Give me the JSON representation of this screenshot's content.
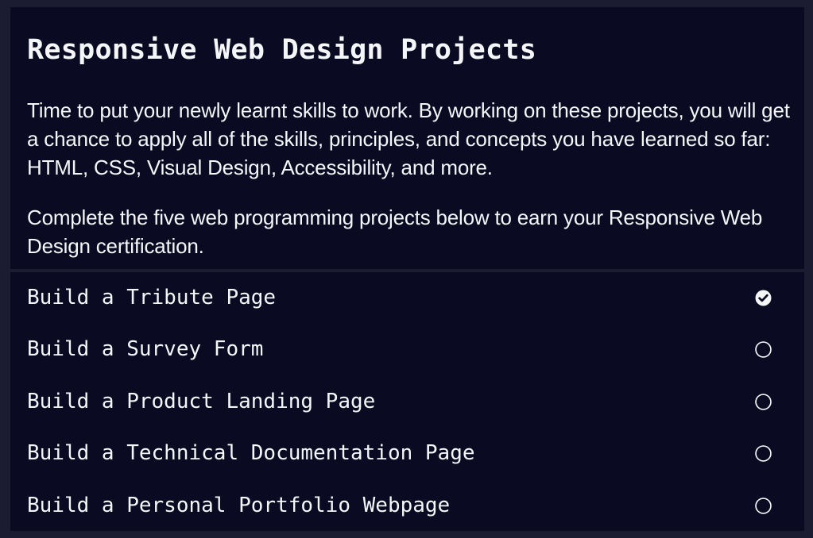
{
  "intro": {
    "title": "Responsive Web Design Projects",
    "paragraphs": [
      "Time to put your newly learnt skills to work. By working on these projects, you will get a chance to apply all of the skills, principles, and concepts you have learned so far: HTML, CSS, Visual Design, Accessibility, and more.",
      "Complete the five web programming projects below to earn your Responsive Web Design certification."
    ]
  },
  "projects": [
    {
      "label": "Build a Tribute Page",
      "completed": true,
      "icon": "check-circle-icon"
    },
    {
      "label": "Build a Survey Form",
      "completed": false,
      "icon": "empty-circle-icon"
    },
    {
      "label": "Build a Product Landing Page",
      "completed": false,
      "icon": "empty-circle-icon"
    },
    {
      "label": "Build a Technical Documentation Page",
      "completed": false,
      "icon": "empty-circle-icon"
    },
    {
      "label": "Build a Personal Portfolio Webpage",
      "completed": false,
      "icon": "empty-circle-icon"
    }
  ],
  "colors": {
    "page_background": "#1b1b32",
    "panel_background": "#0a0a23",
    "text": "#f5f6f7"
  }
}
